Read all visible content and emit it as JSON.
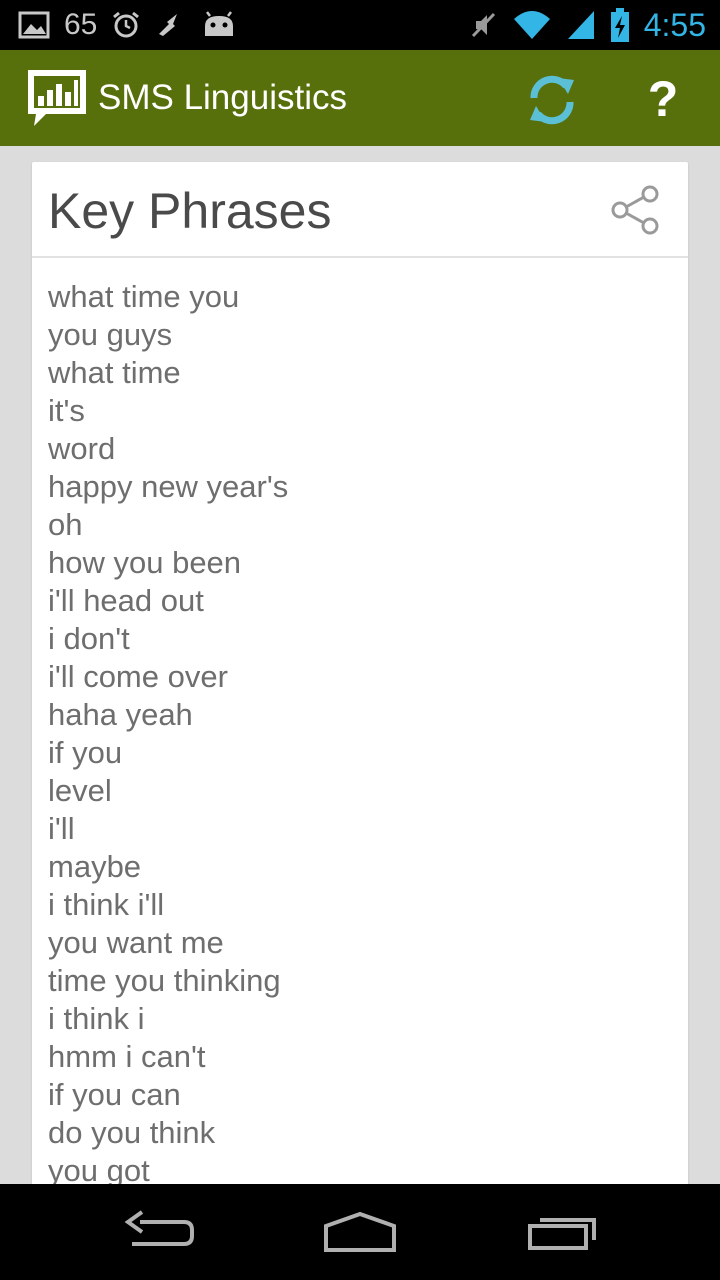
{
  "status_bar": {
    "notification_count": "65",
    "time": "4:55",
    "icons": [
      "image-icon",
      "alarm-icon",
      "usb-icon",
      "android-icon",
      "mute-icon",
      "wifi-icon",
      "signal-icon",
      "battery-charging-icon"
    ]
  },
  "action_bar": {
    "title": "SMS Linguistics",
    "help_label": "?",
    "icons": [
      "app-logo-icon",
      "refresh-icon"
    ],
    "colors": {
      "background": "#58700c",
      "refresh": "#5bc0d6"
    }
  },
  "card": {
    "title": "Key Phrases",
    "share_icon": "share-icon",
    "phrases": [
      "what time you",
      "you guys",
      "what time",
      "it's",
      "word",
      "happy new year's",
      "oh",
      "how you been",
      "i'll head out",
      "i don't",
      "i'll come over",
      "haha yeah",
      "if you",
      "level",
      "i'll",
      "maybe",
      "i think i'll",
      "you want me",
      "time you thinking",
      "i think i",
      "hmm i can't",
      "if you can",
      "do you think",
      "you got"
    ]
  },
  "nav_bar": {
    "icons": [
      "back-icon",
      "home-icon",
      "recents-icon"
    ]
  }
}
